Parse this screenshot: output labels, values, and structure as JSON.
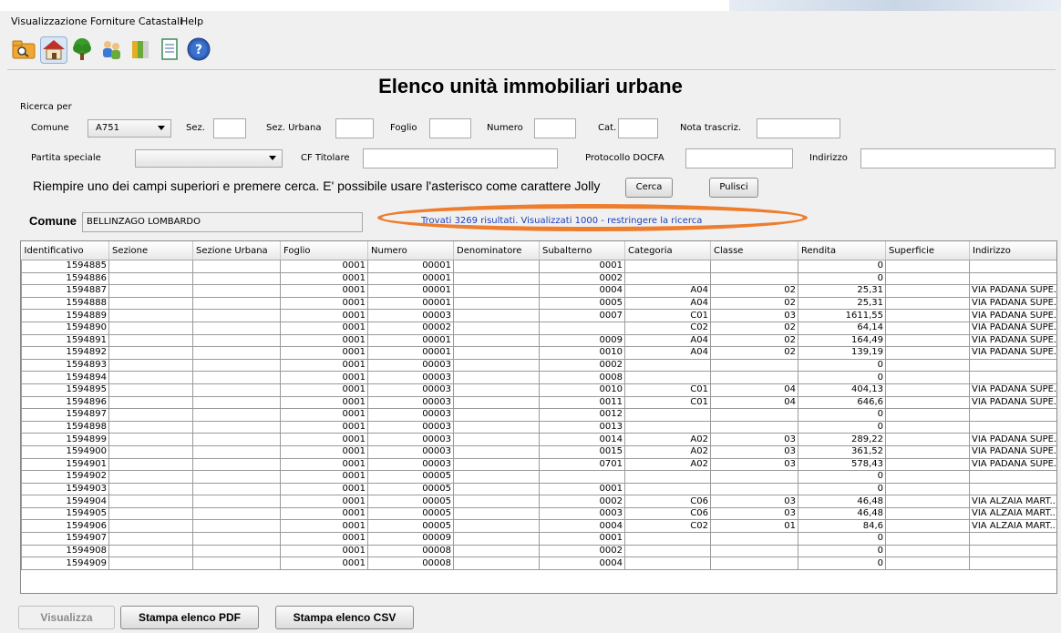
{
  "menu": {
    "app": "Visualizzazione Forniture Catastali",
    "help": "Help"
  },
  "toolbar": [
    "folder-search-icon",
    "house-icon",
    "tree-icon",
    "people-icon",
    "books-icon",
    "document-icon",
    "help-icon"
  ],
  "heading": "Elenco unità immobiliari urbane",
  "search": {
    "legend": "Ricerca per",
    "comune_label": "Comune",
    "comune_value": "A751",
    "sez_label": "Sez.",
    "sez_urbana_label": "Sez. Urbana",
    "foglio_label": "Foglio",
    "numero_label": "Numero",
    "cat_label": "Cat.",
    "nota_label": "Nota trascriz.",
    "partita_label": "Partita speciale",
    "partita_value": "",
    "cf_label": "CF Titolare",
    "protocollo_label": "Protocollo DOCFA",
    "indirizzo_label": "Indirizzo",
    "hint": "Riempire uno dei campi superiori e premere cerca. E' possibile usare l'asterisco come carattere Jolly",
    "cerca": "Cerca",
    "pulisci": "Pulisci"
  },
  "comune_bar": {
    "label": "Comune",
    "value": "BELLINZAGO LOMBARDO",
    "result": "Trovati 3269 risultati. Visualizzati 1000 - restringere la ricerca"
  },
  "table": {
    "columns": [
      "Identificativo",
      "Sezione",
      "Sezione Urbana",
      "Foglio",
      "Numero",
      "Denominatore",
      "Subalterno",
      "Categoria",
      "Classe",
      "Rendita",
      "Superficie",
      "Indirizzo"
    ],
    "rows": [
      [
        "1594885",
        "",
        "",
        "0001",
        "00001",
        "",
        "0001",
        "",
        "",
        "0",
        "",
        ""
      ],
      [
        "1594886",
        "",
        "",
        "0001",
        "00001",
        "",
        "0002",
        "",
        "",
        "0",
        "",
        ""
      ],
      [
        "1594887",
        "",
        "",
        "0001",
        "00001",
        "",
        "0004",
        "A04",
        "02",
        "25,31",
        "",
        "VIA PADANA SUPE..."
      ],
      [
        "1594888",
        "",
        "",
        "0001",
        "00001",
        "",
        "0005",
        "A04",
        "02",
        "25,31",
        "",
        "VIA PADANA SUPE..."
      ],
      [
        "1594889",
        "",
        "",
        "0001",
        "00003",
        "",
        "0007",
        "C01",
        "03",
        "1611,55",
        "",
        "VIA PADANA SUPE..."
      ],
      [
        "1594890",
        "",
        "",
        "0001",
        "00002",
        "",
        "",
        "C02",
        "02",
        "64,14",
        "",
        "VIA PADANA SUPE..."
      ],
      [
        "1594891",
        "",
        "",
        "0001",
        "00001",
        "",
        "0009",
        "A04",
        "02",
        "164,49",
        "",
        "VIA PADANA SUPE..."
      ],
      [
        "1594892",
        "",
        "",
        "0001",
        "00001",
        "",
        "0010",
        "A04",
        "02",
        "139,19",
        "",
        "VIA PADANA SUPE..."
      ],
      [
        "1594893",
        "",
        "",
        "0001",
        "00003",
        "",
        "0002",
        "",
        "",
        "0",
        "",
        ""
      ],
      [
        "1594894",
        "",
        "",
        "0001",
        "00003",
        "",
        "0008",
        "",
        "",
        "0",
        "",
        ""
      ],
      [
        "1594895",
        "",
        "",
        "0001",
        "00003",
        "",
        "0010",
        "C01",
        "04",
        "404,13",
        "",
        "VIA PADANA SUPE..."
      ],
      [
        "1594896",
        "",
        "",
        "0001",
        "00003",
        "",
        "0011",
        "C01",
        "04",
        "646,6",
        "",
        "VIA PADANA SUPE..."
      ],
      [
        "1594897",
        "",
        "",
        "0001",
        "00003",
        "",
        "0012",
        "",
        "",
        "0",
        "",
        ""
      ],
      [
        "1594898",
        "",
        "",
        "0001",
        "00003",
        "",
        "0013",
        "",
        "",
        "0",
        "",
        ""
      ],
      [
        "1594899",
        "",
        "",
        "0001",
        "00003",
        "",
        "0014",
        "A02",
        "03",
        "289,22",
        "",
        "VIA PADANA SUPE..."
      ],
      [
        "1594900",
        "",
        "",
        "0001",
        "00003",
        "",
        "0015",
        "A02",
        "03",
        "361,52",
        "",
        "VIA PADANA SUPE..."
      ],
      [
        "1594901",
        "",
        "",
        "0001",
        "00003",
        "",
        "0701",
        "A02",
        "03",
        "578,43",
        "",
        "VIA PADANA SUPE..."
      ],
      [
        "1594902",
        "",
        "",
        "0001",
        "00005",
        "",
        "",
        "",
        "",
        "0",
        "",
        ""
      ],
      [
        "1594903",
        "",
        "",
        "0001",
        "00005",
        "",
        "0001",
        "",
        "",
        "0",
        "",
        ""
      ],
      [
        "1594904",
        "",
        "",
        "0001",
        "00005",
        "",
        "0002",
        "C06",
        "03",
        "46,48",
        "",
        "VIA ALZAIA MART..."
      ],
      [
        "1594905",
        "",
        "",
        "0001",
        "00005",
        "",
        "0003",
        "C06",
        "03",
        "46,48",
        "",
        "VIA ALZAIA MART..."
      ],
      [
        "1594906",
        "",
        "",
        "0001",
        "00005",
        "",
        "0004",
        "C02",
        "01",
        "84,6",
        "",
        "VIA ALZAIA MART..."
      ],
      [
        "1594907",
        "",
        "",
        "0001",
        "00009",
        "",
        "0001",
        "",
        "",
        "0",
        "",
        ""
      ],
      [
        "1594908",
        "",
        "",
        "0001",
        "00008",
        "",
        "0002",
        "",
        "",
        "0",
        "",
        ""
      ],
      [
        "1594909",
        "",
        "",
        "0001",
        "00008",
        "",
        "0004",
        "",
        "",
        "0",
        "",
        ""
      ]
    ]
  },
  "buttons": {
    "visualizza": "Visualizza",
    "pdf": "Stampa elenco PDF",
    "csv": "Stampa elenco CSV"
  },
  "colors": {
    "highlight_oval": "#ee7d2e",
    "result_text": "#1a3fbf"
  }
}
